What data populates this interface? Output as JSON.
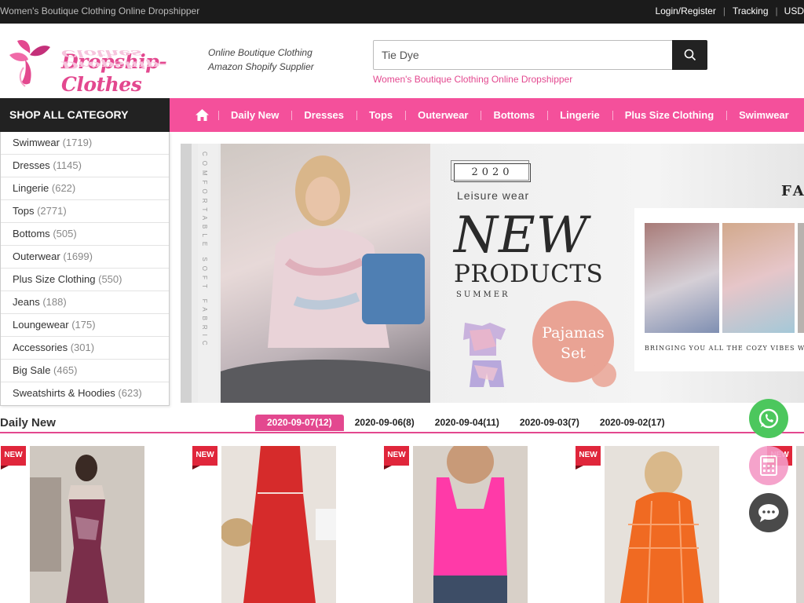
{
  "topbar": {
    "tagline": "Women's Boutique Clothing Online Dropshipper",
    "login": "Login/Register",
    "tracking": "Tracking",
    "currency": "USD"
  },
  "header": {
    "logo_text": "Dropship-Clothes",
    "slogan_line1": "Online Boutique Clothing",
    "slogan_line2": "Amazon Shopify Supplier",
    "search_value": "Tie Dye",
    "search_hint": "Women's Boutique Clothing Online Dropshipper"
  },
  "nav": {
    "shop_all": "SHOP ALL CATEGORY",
    "items": [
      "Daily New",
      "Dresses",
      "Tops",
      "Outerwear",
      "Bottoms",
      "Lingerie",
      "Plus Size Clothing",
      "Swimwear"
    ]
  },
  "sidebar": {
    "categories": [
      {
        "name": "Swimwear",
        "count": "(1719)"
      },
      {
        "name": "Dresses",
        "count": "(1145)"
      },
      {
        "name": "Lingerie",
        "count": "(622)"
      },
      {
        "name": "Tops",
        "count": "(2771)"
      },
      {
        "name": "Bottoms",
        "count": "(505)"
      },
      {
        "name": "Outerwear",
        "count": "(1699)"
      },
      {
        "name": "Plus Size Clothing",
        "count": "(550)"
      },
      {
        "name": "Jeans",
        "count": "(188)"
      },
      {
        "name": "Loungewear",
        "count": "(175)"
      },
      {
        "name": "Accessories",
        "count": "(301)"
      },
      {
        "name": "Big Sale",
        "count": "(465)"
      },
      {
        "name": "Sweatshirts & Hoodies",
        "count": "(623)"
      }
    ]
  },
  "banner": {
    "vertical_text": "COMFORTABLE SOFT FABRIC",
    "year": "2020",
    "leisure": "Leisure wear",
    "new": "NEW",
    "products": "PRODUCTS",
    "summer": "SUMMER",
    "pajamas_line1": "Pajamas",
    "pajamas_line2": "Set",
    "fa": "FA",
    "cozy": "BRINGING YOU ALL THE COZY VIBES W"
  },
  "daily_new": {
    "title": "Daily New",
    "tabs": [
      "2020-09-07(12)",
      "2020-09-06(8)",
      "2020-09-04(11)",
      "2020-09-03(7)",
      "2020-09-02(17)"
    ],
    "active_tab": 0,
    "badge": "NEW"
  },
  "colors": {
    "brand_pink": "#f4509b",
    "accent_pink": "#e3488f",
    "whatsapp_green": "#4cc75d",
    "chat_gray": "#4a4a4a"
  }
}
